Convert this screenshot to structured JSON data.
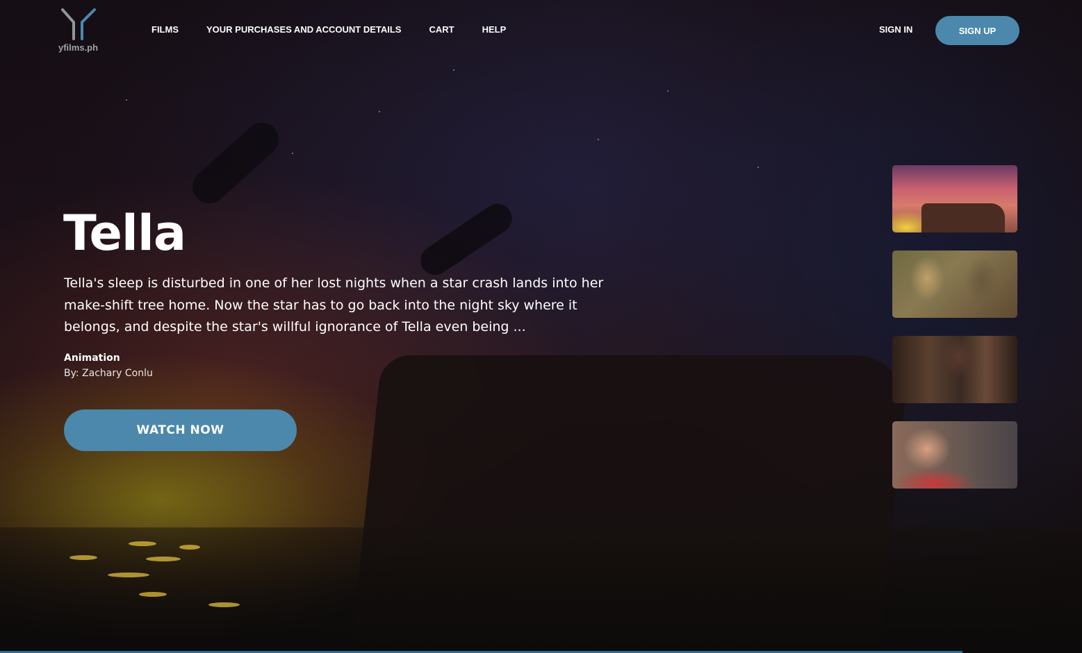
{
  "brand": {
    "name": "yfilms.ph",
    "accent_color": "#4b88ac"
  },
  "nav": {
    "items": [
      {
        "label": "FILMS"
      },
      {
        "label": "YOUR PURCHASES AND ACCOUNT DETAILS"
      },
      {
        "label": "CART"
      },
      {
        "label": "HELP"
      }
    ],
    "sign_in": "SIGN IN",
    "sign_up": "SIGN UP"
  },
  "featured": {
    "title": "Tella",
    "description": "Tella's sleep is disturbed in one of her lost nights when a star crash lands into her make-shift tree home. Now the star has to go back into the night sky where it belongs, and despite the star's willful ignorance of Tella even being ...",
    "genre": "Animation",
    "author": "By: Zachary Conlu",
    "watch_label": "WATCH NOW"
  }
}
